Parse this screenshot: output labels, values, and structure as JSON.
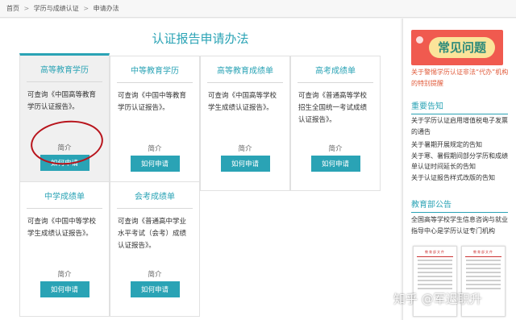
{
  "breadcrumb": {
    "home": "首页",
    "section": "学历与成绩认证",
    "current": "申请办法",
    "sep": ">"
  },
  "main": {
    "title": "认证报告申请办法",
    "cards": [
      {
        "title": "高等教育学历",
        "desc": "可查询《中国高等教育学历认证报告》。",
        "intro": "简介",
        "button": "如何申请"
      },
      {
        "title": "中等教育学历",
        "desc": "可查询《中国中等教育学历认证报告》。",
        "intro": "简介",
        "button": "如何申请"
      },
      {
        "title": "高等教育成绩单",
        "desc": "可查询《中国高等学校学生成绩认证报告》。",
        "intro": "简介",
        "button": "如何申请"
      },
      {
        "title": "高考成绩单",
        "desc": "可查询《普通高等学校招生全国统一考试成绩认证报告》。",
        "intro": "简介",
        "button": "如何申请"
      },
      {
        "title": "中学成绩单",
        "desc": "可查询《中国中等学校学生成绩认证报告》。",
        "intro": "简介",
        "button": "如何申请"
      },
      {
        "title": "会考成绩单",
        "desc": "可查询《普通高中学业水平考试（会考）成绩认证报告》。",
        "intro": "简介",
        "button": "如何申请"
      }
    ]
  },
  "sidebar": {
    "faq_banner": "常见问题",
    "faq_link": "关于警惕学历认证非法“代办”机构的特别提醒",
    "notice_title": "重要告知",
    "notices": [
      "关于学历认证启用增值税电子发票的通告",
      "关于暑期开展规定的告知",
      "关于寒、暑假期间部分学历和成绩单认证时间延长的告知",
      "关于认证报告样式改版的告知"
    ],
    "ministry_title": "教育部公告",
    "ministry_items": [
      "全国高等学校学生信息咨询与就业指导中心是学历认证专门机构"
    ],
    "thumb_header": "教育部文件"
  },
  "watermark": "知乎 @军迟职升",
  "colors": {
    "accent": "#2aa3b5",
    "red_link": "#e05a3a",
    "annotation": "#b8141c"
  }
}
